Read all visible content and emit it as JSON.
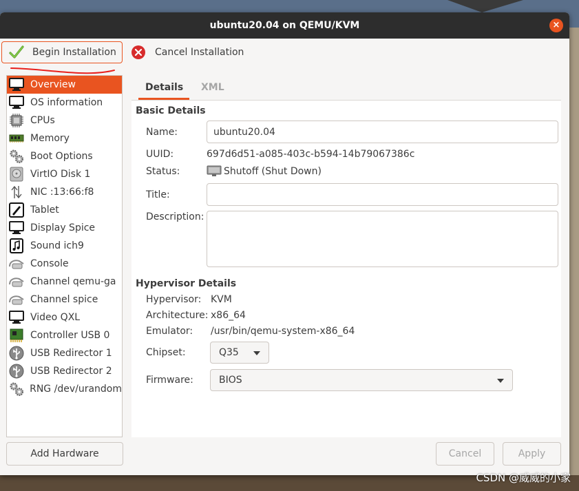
{
  "window": {
    "title": "ubuntu20.04 on QEMU/KVM",
    "close_glyph": "×"
  },
  "toolbar": {
    "begin_label": "Begin Installation",
    "cancel_label": "Cancel Installation",
    "begin_icon": "check-icon",
    "cancel_icon": "cancel-icon"
  },
  "sidebar": {
    "items": [
      {
        "label": "Overview",
        "icon": "monitor-icon",
        "selected": true
      },
      {
        "label": "OS information",
        "icon": "monitor-icon"
      },
      {
        "label": "CPUs",
        "icon": "cpu-icon"
      },
      {
        "label": "Memory",
        "icon": "memory-icon"
      },
      {
        "label": "Boot Options",
        "icon": "gears-icon"
      },
      {
        "label": "VirtIO Disk 1",
        "icon": "disk-icon"
      },
      {
        "label": "NIC :13:66:f8",
        "icon": "network-icon"
      },
      {
        "label": "Tablet",
        "icon": "tablet-icon"
      },
      {
        "label": "Display Spice",
        "icon": "monitor-icon"
      },
      {
        "label": "Sound ich9",
        "icon": "sound-icon"
      },
      {
        "label": "Console",
        "icon": "serial-icon"
      },
      {
        "label": "Channel qemu-ga",
        "icon": "serial-icon"
      },
      {
        "label": "Channel spice",
        "icon": "serial-icon"
      },
      {
        "label": "Video QXL",
        "icon": "monitor-icon"
      },
      {
        "label": "Controller USB 0",
        "icon": "pci-card-icon"
      },
      {
        "label": "USB Redirector 1",
        "icon": "usb-icon"
      },
      {
        "label": "USB Redirector 2",
        "icon": "usb-icon"
      },
      {
        "label": "RNG /dev/urandom",
        "icon": "gears-icon"
      }
    ],
    "add_hardware_label": "Add Hardware"
  },
  "tabs": [
    {
      "label": "Details",
      "active": true
    },
    {
      "label": "XML",
      "active": false
    }
  ],
  "basic": {
    "section_title": "Basic Details",
    "name_label": "Name:",
    "name_value": "ubuntu20.04",
    "uuid_label": "UUID:",
    "uuid_value": "697d6d51-a085-403c-b594-14b79067386c",
    "status_label": "Status:",
    "status_value": "Shutoff (Shut Down)",
    "status_icon": "shutoff-monitor-icon",
    "title_label": "Title:",
    "title_value": "",
    "description_label": "Description:",
    "description_value": ""
  },
  "hypervisor": {
    "section_title": "Hypervisor Details",
    "hypervisor_label": "Hypervisor:",
    "hypervisor_value": "KVM",
    "architecture_label": "Architecture:",
    "architecture_value": "x86_64",
    "emulator_label": "Emulator:",
    "emulator_value": "/usr/bin/qemu-system-x86_64",
    "chipset_label": "Chipset:",
    "chipset_value": "Q35",
    "firmware_label": "Firmware:",
    "firmware_value": "BIOS"
  },
  "footer": {
    "cancel_label": "Cancel",
    "apply_label": "Apply"
  },
  "watermark": "CSDN @威威的小家",
  "colors": {
    "accent": "#e95420",
    "titlebar": "#2d2d2d",
    "window_bg": "#f6f5f4",
    "annotation_red": "#e8201c"
  }
}
